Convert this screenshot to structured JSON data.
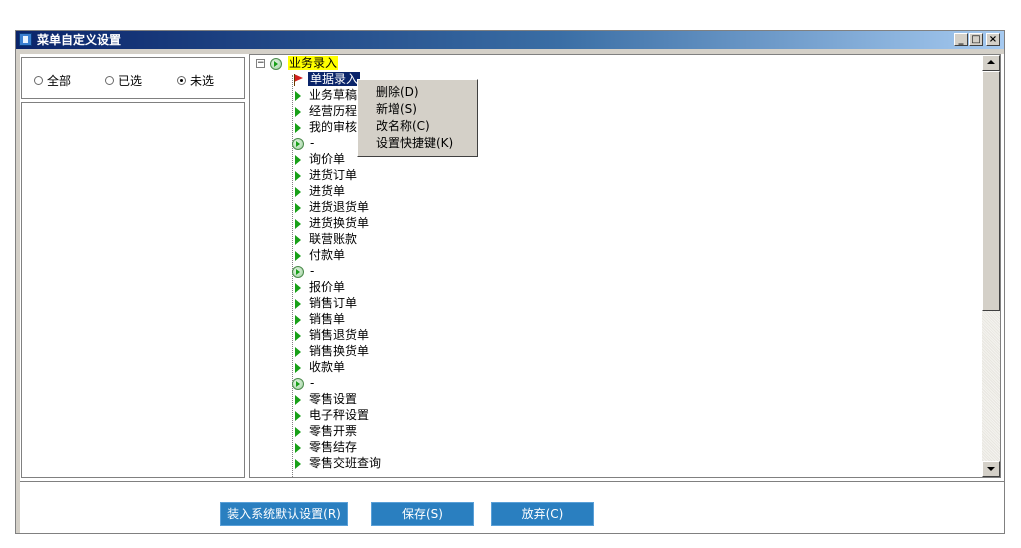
{
  "window": {
    "title": "菜单自定义设置",
    "controls": {
      "minimize": "_",
      "maximize": "□",
      "close": "×"
    }
  },
  "filter": {
    "options": [
      {
        "label": "全部",
        "checked": false
      },
      {
        "label": "已选",
        "checked": false
      },
      {
        "label": "未选",
        "checked": true
      }
    ]
  },
  "tree": {
    "root": "业务录入",
    "selected": "单据录入",
    "items_under_selected": [
      "业务草稿",
      "经营历程",
      "我的审核"
    ],
    "items": [
      {
        "label": "-",
        "type": "separator"
      },
      {
        "label": "询价单",
        "type": "item"
      },
      {
        "label": "进货订单",
        "type": "item"
      },
      {
        "label": "进货单",
        "type": "item"
      },
      {
        "label": "进货退货单",
        "type": "item"
      },
      {
        "label": "进货换货单",
        "type": "item"
      },
      {
        "label": "联营账款",
        "type": "item"
      },
      {
        "label": "付款单",
        "type": "item"
      },
      {
        "label": "-",
        "type": "separator"
      },
      {
        "label": "报价单",
        "type": "item"
      },
      {
        "label": "销售订单",
        "type": "item"
      },
      {
        "label": "销售单",
        "type": "item"
      },
      {
        "label": "销售退货单",
        "type": "item"
      },
      {
        "label": "销售换货单",
        "type": "item"
      },
      {
        "label": "收款单",
        "type": "item"
      },
      {
        "label": "-",
        "type": "separator"
      },
      {
        "label": "零售设置",
        "type": "item"
      },
      {
        "label": "电子秤设置",
        "type": "item"
      },
      {
        "label": "零售开票",
        "type": "item"
      },
      {
        "label": "零售结存",
        "type": "item"
      },
      {
        "label": "零售交班查询",
        "type": "item"
      }
    ]
  },
  "context_menu": {
    "items": [
      "删除(D)",
      "新增(S)",
      "改名称(C)",
      "设置快捷键(K)"
    ]
  },
  "buttons": {
    "load_default": "装入系统默认设置(R)",
    "save": "保存(S)",
    "cancel": "放弃(C)"
  }
}
